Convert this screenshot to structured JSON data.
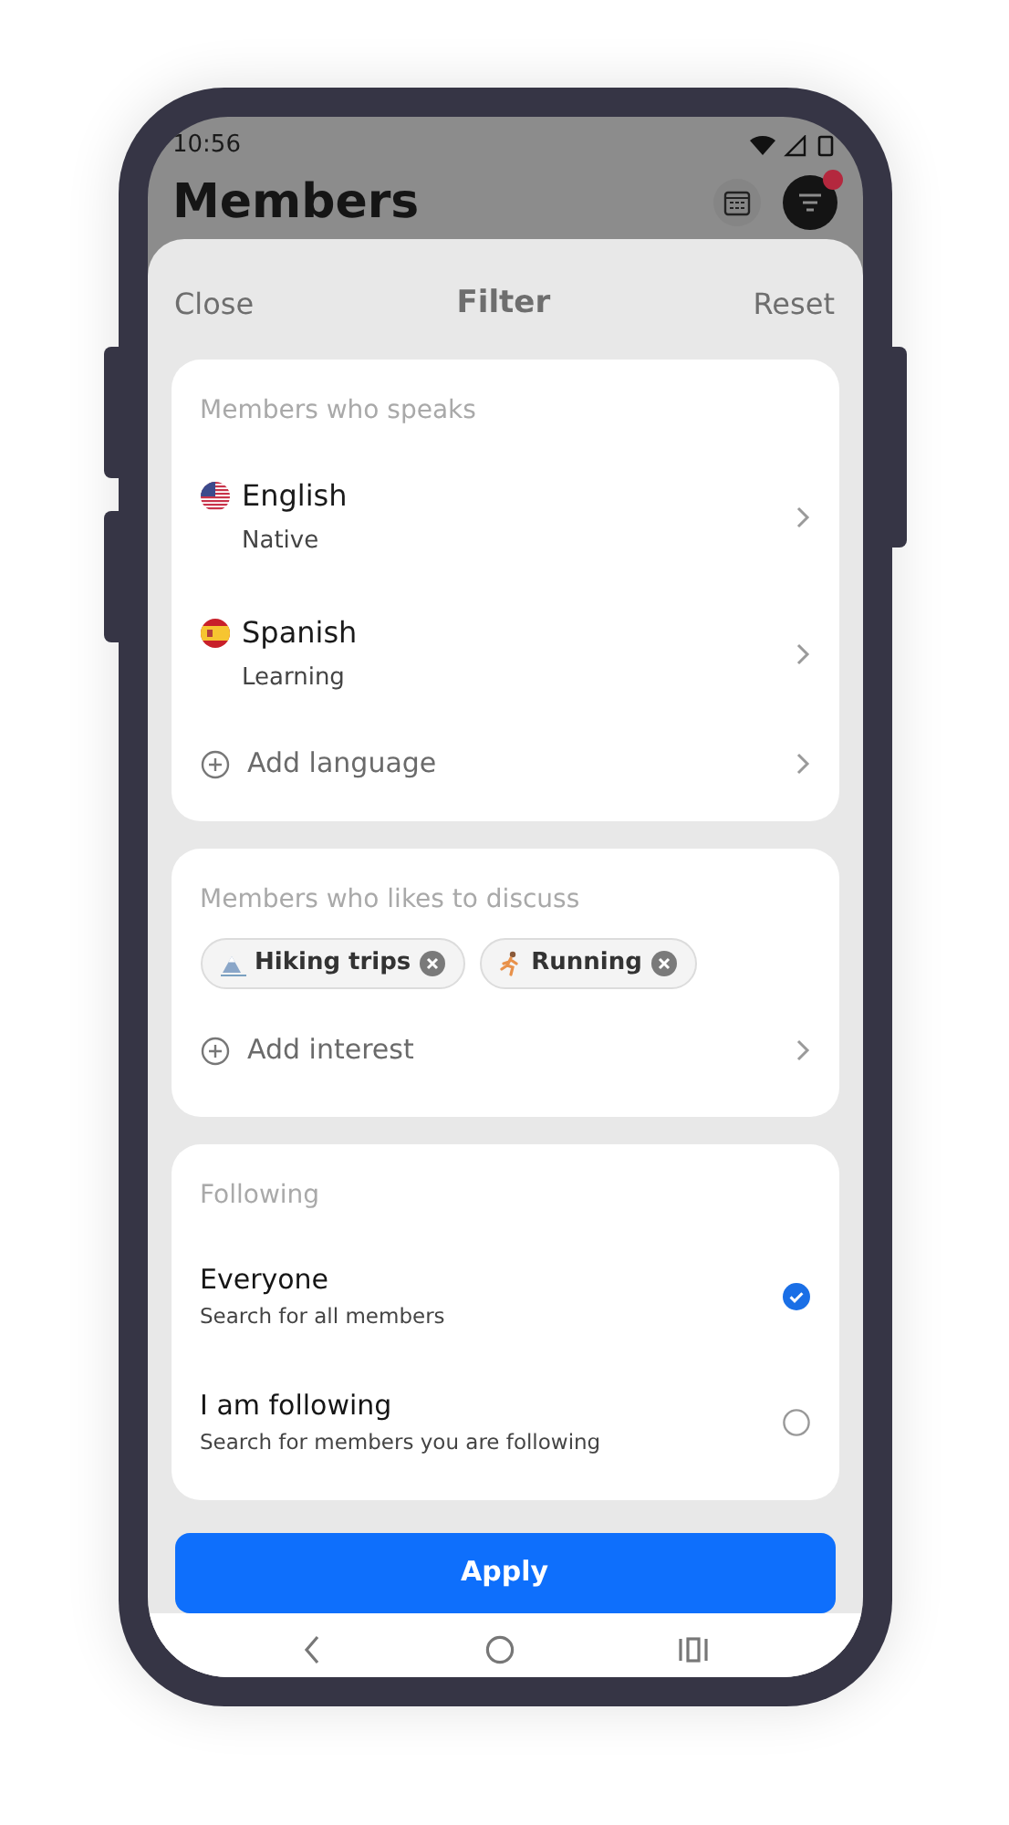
{
  "status_bar": {
    "time": "10:56"
  },
  "page": {
    "title": "Members",
    "has_notification": true
  },
  "sheet": {
    "close": "Close",
    "title": "Filter",
    "reset": "Reset"
  },
  "languages": {
    "heading": "Members who speaks",
    "items": [
      {
        "kind": "us",
        "name": "English",
        "level": "Native"
      },
      {
        "kind": "es",
        "name": "Spanish",
        "level": "Learning"
      }
    ],
    "add": "Add language"
  },
  "interests": {
    "heading": "Members who likes to discuss",
    "chips": [
      {
        "kind": "hiking",
        "label": "Hiking trips"
      },
      {
        "kind": "running",
        "label": "Running"
      }
    ],
    "add": "Add interest"
  },
  "following": {
    "heading": "Following",
    "options": [
      {
        "title": "Everyone",
        "subtitle": "Search for all members",
        "selected": true
      },
      {
        "title": "I am following",
        "subtitle": "Search for members you are following",
        "selected": false
      }
    ]
  },
  "apply": "Apply"
}
